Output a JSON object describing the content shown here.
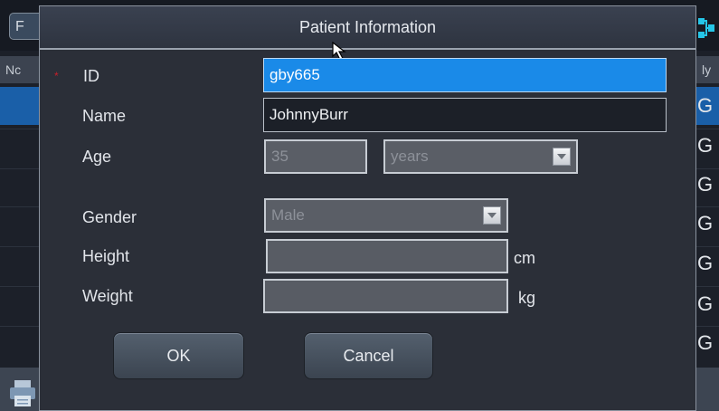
{
  "background": {
    "tab_partial_label": "F",
    "list_header_left": "Nc",
    "list_header_right": "ly",
    "row_suffix": "G"
  },
  "dialog": {
    "title": "Patient Information",
    "required_marker": "*",
    "fields": {
      "id": {
        "label": "ID",
        "value": "gby665"
      },
      "name": {
        "label": "Name",
        "value": "JohnnyBurr"
      },
      "age": {
        "label": "Age",
        "value": "35",
        "unit_selected": "years"
      },
      "gender": {
        "label": "Gender",
        "selected": "Male"
      },
      "height": {
        "label": "Height",
        "value": "",
        "unit": "cm"
      },
      "weight": {
        "label": "Weight",
        "value": "",
        "unit": "kg"
      }
    },
    "buttons": {
      "ok": "OK",
      "cancel": "Cancel"
    }
  },
  "colors": {
    "selected_field": "#1a8ae8",
    "required": "#c81f2a",
    "selected_row": "#1a5fa8"
  }
}
